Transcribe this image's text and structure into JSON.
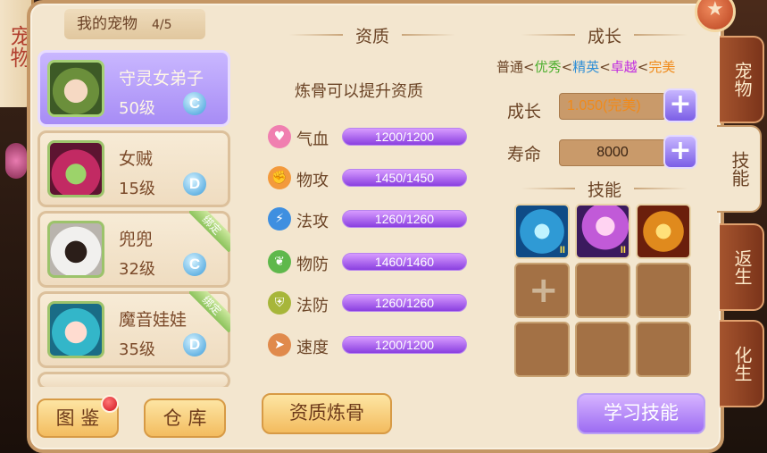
{
  "side_label": "宠物",
  "pet_list": {
    "header_title": "我的宠物",
    "header_count": "4/5",
    "pets": [
      {
        "name": "守灵女弟子",
        "level": "50级",
        "grade": "C",
        "bound": false,
        "selected": true
      },
      {
        "name": "女贼",
        "level": "15级",
        "grade": "D",
        "bound": false,
        "selected": false
      },
      {
        "name": "兜兜",
        "level": "32级",
        "grade": "C",
        "bound": true,
        "selected": false
      },
      {
        "name": "魔音娃娃",
        "level": "35级",
        "grade": "D",
        "bound": true,
        "selected": false
      }
    ],
    "bound_label": "绑定"
  },
  "buttons": {
    "atlas": "图 鉴",
    "warehouse": "仓 库",
    "refine": "资质炼骨",
    "learn": "学习技能"
  },
  "aptitude": {
    "title": "资质",
    "hint": "炼骨可以提升资质",
    "stats": [
      {
        "icon": "heart-icon",
        "label": "气血",
        "value": "1200/1200",
        "color": "#f07fb0"
      },
      {
        "icon": "fist-icon",
        "label": "物攻",
        "value": "1450/1450",
        "color": "#f39a3c"
      },
      {
        "icon": "lightning-icon",
        "label": "法攻",
        "value": "1260/1260",
        "color": "#3f8fe0"
      },
      {
        "icon": "leaf-icon",
        "label": "物防",
        "value": "1460/1460",
        "color": "#5fb84c"
      },
      {
        "icon": "shield-icon",
        "label": "法防",
        "value": "1260/1260",
        "color": "#a7b63a"
      },
      {
        "icon": "boot-icon",
        "label": "速度",
        "value": "1200/1200",
        "color": "#e08a4c"
      }
    ]
  },
  "growth": {
    "title": "成长",
    "grades": [
      {
        "label": "普通",
        "color": "#6b4426"
      },
      {
        "label": "优秀",
        "color": "#4caf2e"
      },
      {
        "label": "精英",
        "color": "#2f8fd6"
      },
      {
        "label": "卓越",
        "color": "#c02be0"
      },
      {
        "label": "完美",
        "color": "#f08a1a"
      }
    ],
    "growth_label": "成长",
    "growth_value": "1.050(完美)",
    "growth_value_color": "#f08a1a",
    "life_label": "寿命",
    "life_value": "8000"
  },
  "skills": {
    "title": "技能",
    "owned": [
      {
        "icon": "ice-cross-skill-icon",
        "level": "II"
      },
      {
        "icon": "magic-staff-skill-icon",
        "level": "II"
      },
      {
        "icon": "fire-blade-skill-icon",
        "level": ""
      }
    ]
  },
  "tabs": [
    {
      "label": "宠物",
      "active": false
    },
    {
      "label": "技能",
      "active": true
    },
    {
      "label": "返生",
      "active": false
    },
    {
      "label": "化生",
      "active": false
    }
  ]
}
